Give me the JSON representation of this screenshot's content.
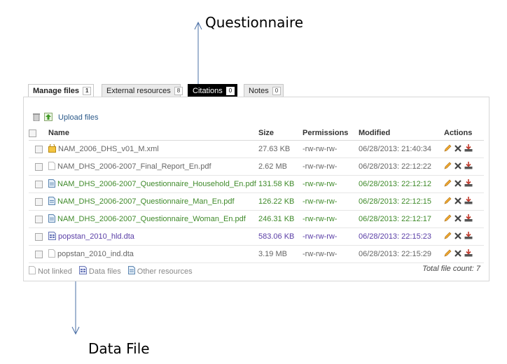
{
  "annotations": {
    "top": "Questionnaire",
    "bottom": "Data File"
  },
  "tabs": [
    {
      "label": "Manage files",
      "count": "1",
      "state": "active"
    },
    {
      "label": "External resources",
      "count": "8",
      "state": "normal"
    },
    {
      "label": "Citations",
      "count": "0",
      "state": "dark"
    },
    {
      "label": "Notes",
      "count": "0",
      "state": "normal"
    }
  ],
  "toolbar": {
    "upload_label": "Upload files",
    "icons": [
      "trash-icon",
      "upload-icon"
    ]
  },
  "table": {
    "headers": {
      "name": "Name",
      "size": "Size",
      "permissions": "Permissions",
      "modified": "Modified",
      "actions": "Actions"
    },
    "rows": [
      {
        "name": "NAM_2006_DHS_v01_M.xml",
        "size": "27.63 KB",
        "permissions": "-rw-rw-rw-",
        "modified": "06/28/2013: 21:40:34",
        "icon": "xml-file-icon",
        "tone": "gray"
      },
      {
        "name": "NAM_DHS_2006-2007_Final_Report_En.pdf",
        "size": "2.62 MB",
        "permissions": "-rw-rw-rw-",
        "modified": "06/28/2013: 22:12:22",
        "icon": "file-not-linked-icon",
        "tone": "gray"
      },
      {
        "name": "NAM_DHS_2006-2007_Questionnaire_Household_En.pdf",
        "size": "131.58 KB",
        "permissions": "-rw-rw-rw-",
        "modified": "06/28/2013: 22:12:12",
        "icon": "resource-file-icon",
        "tone": "green"
      },
      {
        "name": "NAM_DHS_2006-2007_Questionnaire_Man_En.pdf",
        "size": "126.22 KB",
        "permissions": "-rw-rw-rw-",
        "modified": "06/28/2013: 22:12:15",
        "icon": "resource-file-icon",
        "tone": "green"
      },
      {
        "name": "NAM_DHS_2006-2007_Questionnaire_Woman_En.pdf",
        "size": "246.31 KB",
        "permissions": "-rw-rw-rw-",
        "modified": "06/28/2013: 22:12:17",
        "icon": "resource-file-icon",
        "tone": "green"
      },
      {
        "name": "popstan_2010_hld.dta",
        "size": "583.06 KB",
        "permissions": "-rw-rw-rw-",
        "modified": "06/28/2013: 22:15:23",
        "icon": "data-file-icon",
        "tone": "purple"
      },
      {
        "name": "popstan_2010_ind.dta",
        "size": "3.19 MB",
        "permissions": "-rw-rw-rw-",
        "modified": "06/28/2013: 22:15:29",
        "icon": "file-not-linked-icon",
        "tone": "gray"
      }
    ],
    "row_actions": [
      "edit-icon",
      "delete-icon",
      "download-icon"
    ]
  },
  "legend": [
    {
      "label": "Not linked",
      "icon": "file-not-linked-icon"
    },
    {
      "label": "Data files",
      "icon": "data-file-icon"
    },
    {
      "label": "Other resources",
      "icon": "resource-file-icon"
    }
  ],
  "footer": {
    "total": "Total file count: 7"
  },
  "colors": {
    "green_text": "#3f8a2a",
    "purple_text": "#5a3ea6",
    "gray_text": "#666666",
    "link": "#2c5a8a"
  }
}
